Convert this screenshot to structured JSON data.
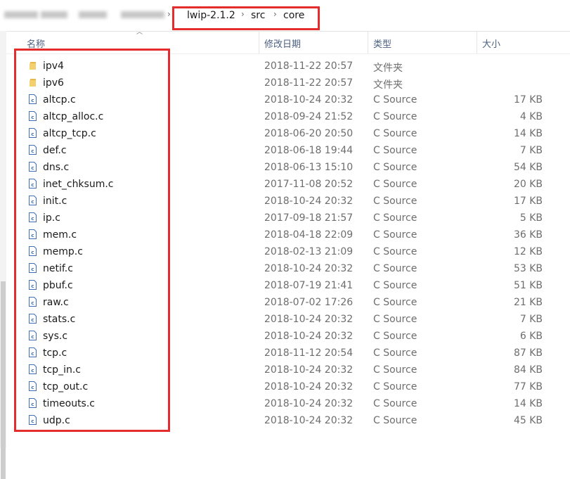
{
  "breadcrumb": {
    "items": [
      "lwip-2.1.2",
      "src",
      "core"
    ],
    "separator": "›"
  },
  "columns": {
    "name": "名称",
    "modified": "修改日期",
    "type": "类型",
    "size": "大小"
  },
  "colors": {
    "highlight": "#e32d2d",
    "folder": "#e8b84a",
    "header_text": "#4d6082",
    "file_icon": "#3d6fb6"
  },
  "files": [
    {
      "name": "ipv4",
      "modified": "2018-11-22 20:57",
      "type": "文件夹",
      "size": "",
      "icon": "folder-icon"
    },
    {
      "name": "ipv6",
      "modified": "2018-11-22 20:57",
      "type": "文件夹",
      "size": "",
      "icon": "folder-icon"
    },
    {
      "name": "altcp.c",
      "modified": "2018-10-24 20:32",
      "type": "C Source",
      "size": "17 KB",
      "icon": "c-file-icon"
    },
    {
      "name": "altcp_alloc.c",
      "modified": "2018-09-24 21:52",
      "type": "C Source",
      "size": "4 KB",
      "icon": "c-file-icon"
    },
    {
      "name": "altcp_tcp.c",
      "modified": "2018-06-20 20:50",
      "type": "C Source",
      "size": "14 KB",
      "icon": "c-file-icon"
    },
    {
      "name": "def.c",
      "modified": "2018-06-18 19:44",
      "type": "C Source",
      "size": "7 KB",
      "icon": "c-file-icon"
    },
    {
      "name": "dns.c",
      "modified": "2018-06-13 15:10",
      "type": "C Source",
      "size": "54 KB",
      "icon": "c-file-icon"
    },
    {
      "name": "inet_chksum.c",
      "modified": "2017-11-08 20:52",
      "type": "C Source",
      "size": "20 KB",
      "icon": "c-file-icon"
    },
    {
      "name": "init.c",
      "modified": "2018-10-24 20:32",
      "type": "C Source",
      "size": "17 KB",
      "icon": "c-file-icon"
    },
    {
      "name": "ip.c",
      "modified": "2017-09-18 21:57",
      "type": "C Source",
      "size": "5 KB",
      "icon": "c-file-icon"
    },
    {
      "name": "mem.c",
      "modified": "2018-04-18 22:09",
      "type": "C Source",
      "size": "36 KB",
      "icon": "c-file-icon"
    },
    {
      "name": "memp.c",
      "modified": "2018-02-13 21:09",
      "type": "C Source",
      "size": "12 KB",
      "icon": "c-file-icon"
    },
    {
      "name": "netif.c",
      "modified": "2018-10-24 20:32",
      "type": "C Source",
      "size": "53 KB",
      "icon": "c-file-icon"
    },
    {
      "name": "pbuf.c",
      "modified": "2018-07-19 21:41",
      "type": "C Source",
      "size": "51 KB",
      "icon": "c-file-icon"
    },
    {
      "name": "raw.c",
      "modified": "2018-07-02 17:26",
      "type": "C Source",
      "size": "21 KB",
      "icon": "c-file-icon"
    },
    {
      "name": "stats.c",
      "modified": "2018-10-24 20:32",
      "type": "C Source",
      "size": "7 KB",
      "icon": "c-file-icon"
    },
    {
      "name": "sys.c",
      "modified": "2018-10-24 20:32",
      "type": "C Source",
      "size": "6 KB",
      "icon": "c-file-icon"
    },
    {
      "name": "tcp.c",
      "modified": "2018-11-12 20:54",
      "type": "C Source",
      "size": "87 KB",
      "icon": "c-file-icon"
    },
    {
      "name": "tcp_in.c",
      "modified": "2018-10-24 20:32",
      "type": "C Source",
      "size": "84 KB",
      "icon": "c-file-icon"
    },
    {
      "name": "tcp_out.c",
      "modified": "2018-10-24 20:32",
      "type": "C Source",
      "size": "77 KB",
      "icon": "c-file-icon"
    },
    {
      "name": "timeouts.c",
      "modified": "2018-10-24 20:32",
      "type": "C Source",
      "size": "14 KB",
      "icon": "c-file-icon"
    },
    {
      "name": "udp.c",
      "modified": "2018-10-24 20:32",
      "type": "C Source",
      "size": "45 KB",
      "icon": "c-file-icon"
    }
  ]
}
